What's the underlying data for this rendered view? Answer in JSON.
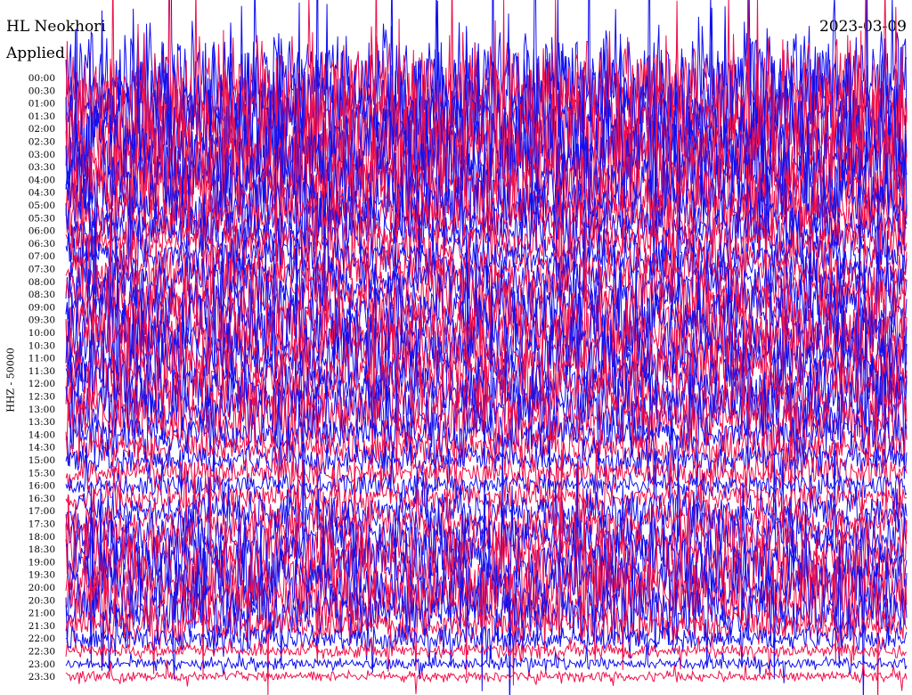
{
  "header": {
    "station": "HL Neokhori",
    "filter": "Applied",
    "date": "2023-03-09"
  },
  "chart_data": {
    "type": "line",
    "title": "HL Neokhori",
    "subtitle": "Applied",
    "date": "2023-03-09",
    "ylabel": "HHZ - 50000",
    "rows": [
      "00:00",
      "00:30",
      "01:00",
      "01:30",
      "02:00",
      "02:30",
      "03:00",
      "03:30",
      "04:00",
      "04:30",
      "05:00",
      "05:30",
      "06:00",
      "06:30",
      "07:00",
      "07:30",
      "08:00",
      "08:30",
      "09:00",
      "09:30",
      "10:00",
      "10:30",
      "11:00",
      "11:30",
      "12:00",
      "12:30",
      "13:00",
      "13:30",
      "14:00",
      "14:30",
      "15:00",
      "15:30",
      "16:00",
      "16:30",
      "17:00",
      "17:30",
      "18:00",
      "18:30",
      "19:00",
      "19:30",
      "20:00",
      "20:30",
      "21:00",
      "21:30",
      "22:00",
      "22:30",
      "23:00",
      "23:30"
    ],
    "colors": [
      "#1010f0",
      "#f0104a"
    ],
    "relative_amplitude": [
      9.0,
      9.0,
      9.0,
      9.0,
      9.0,
      8.5,
      8.5,
      8.0,
      8.0,
      7.0,
      5.0,
      4.5,
      4.0,
      4.0,
      3.5,
      3.5,
      4.5,
      5.0,
      5.5,
      6.0,
      6.0,
      6.0,
      5.5,
      5.0,
      5.0,
      5.0,
      5.5,
      5.0,
      3.5,
      3.0,
      2.5,
      2.5,
      2.0,
      2.5,
      3.0,
      3.5,
      4.5,
      5.0,
      5.5,
      6.0,
      6.0,
      5.5,
      5.0,
      3.0,
      2.0,
      1.2,
      1.0,
      0.9
    ]
  }
}
